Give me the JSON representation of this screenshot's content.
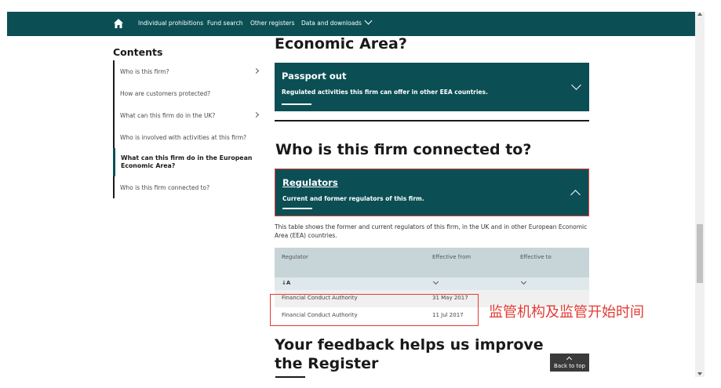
{
  "nav": {
    "items": [
      "Individual prohibitions",
      "Fund search",
      "Other registers",
      "Data and downloads"
    ]
  },
  "sidebar": {
    "title": "Contents",
    "items": [
      {
        "label": "Who is this firm?"
      },
      {
        "label": "How are customers protected?"
      },
      {
        "label": "What can this firm do in the UK?"
      },
      {
        "label": "Who is involved with activities at this firm?"
      },
      {
        "label": "What can this firm do in the European Economic Area?"
      },
      {
        "label": "Who is this firm connected to?"
      }
    ]
  },
  "main": {
    "eea_heading": "Economic Area?",
    "passport": {
      "title": "Passport out",
      "subtitle": "Regulated activities this firm can offer in other EEA countries."
    },
    "connected_heading": "Who is this firm connected to?",
    "regulators": {
      "title": "Regulators",
      "subtitle": "Current and former regulators of this firm."
    },
    "intro": "This table shows the former and current regulators of this firm, in the UK and in other European Economic Area (EEA) countries.",
    "table": {
      "headers": [
        "Regulator",
        "Effective from",
        "Effective to"
      ],
      "sort_label": "↓A",
      "rows": [
        {
          "regulator": "Financial Conduct Authority",
          "from": "31 May 2017",
          "to": ""
        },
        {
          "regulator": "Financial Conduct Authority",
          "from": "11 Jul 2017",
          "to": ""
        }
      ]
    },
    "annotation": "监管机构及监管开始时间",
    "feedback_heading": "Your feedback helps us improve the Register",
    "back_to_top": "Back to top"
  },
  "colors": {
    "brand": "#0b4f55",
    "annotation": "#e23b33"
  }
}
